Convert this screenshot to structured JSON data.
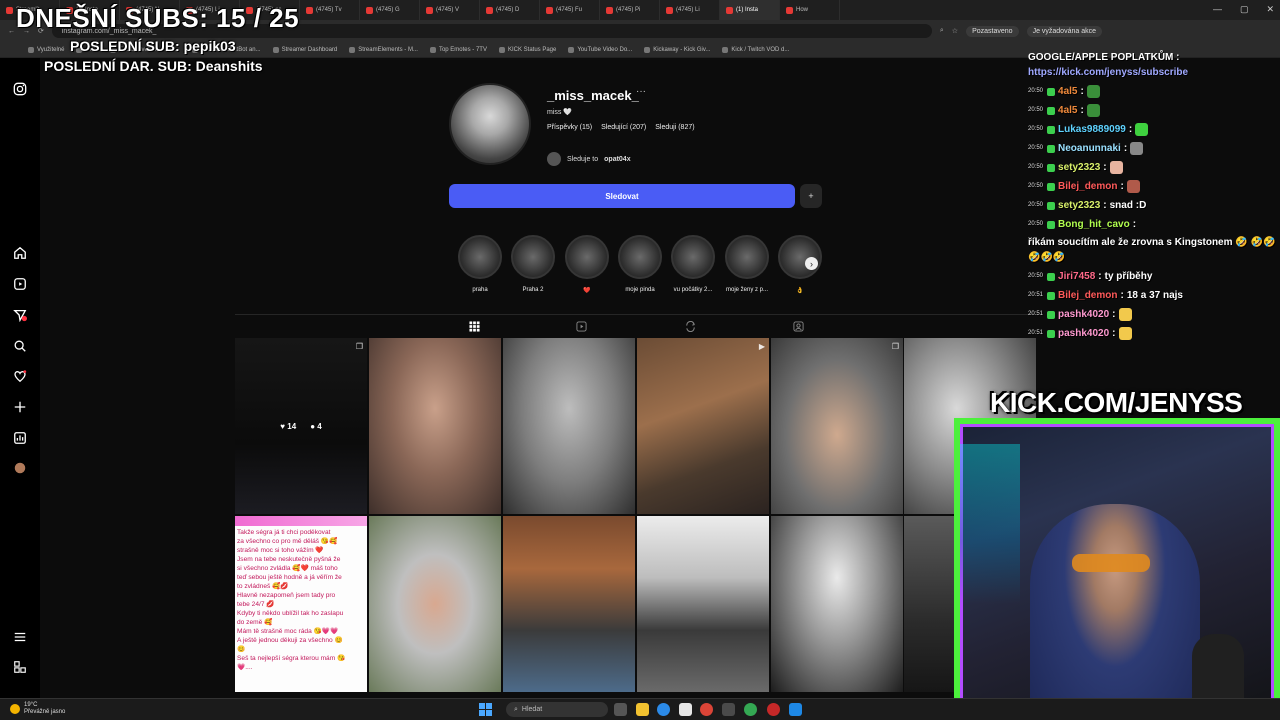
{
  "browser": {
    "tabs": [
      "Streamlit",
      "(4) Insta",
      "(4745) N",
      "(4745) Li",
      "(4745) gc",
      "(4745) Tv",
      "(4745) G",
      "(4745) V",
      "(4745) D",
      "(4745) Fu",
      "(4745) Pi",
      "(4745) Li",
      "(1) Insta",
      "How"
    ],
    "active_tab": 12,
    "url": "instagram.com/_miss_macek_",
    "profile_label": "Pozastaveno",
    "update_label": "Je vyžadována akce",
    "bookmarks": [
      "Využitelné",
      "Chat",
      "File Converter - Free...",
      "The best ChatBot an...",
      "Streamer Dashboard",
      "StreamElements - M...",
      "Top Emotes - 7TV",
      "KICK Status Page",
      "YouTube Video Do...",
      "Kickaway - Kick Giv...",
      "Kick / Twitch VOD d..."
    ]
  },
  "overlay": {
    "subs": "DNEŠNÍ SUBS: 15 / 25",
    "last_sub": "POSLEDNÍ SUB: pepik03",
    "last_dar": "POSLEDNÍ DAR. SUB: Deanshits",
    "kick_url": "KICK.COM/JENYSS"
  },
  "profile": {
    "username": "_miss_macek_",
    "more": "···",
    "bio": "miss 🤍",
    "stats": [
      "Příspěvky (15)",
      "Sledující (207)",
      "Sleduji (827)"
    ],
    "followed_by_prefix": "Sleduje to",
    "followed_by_user": "opat04x",
    "follow_button": "Sledovat",
    "suggest_icon": "+"
  },
  "highlights": [
    {
      "label": "praha"
    },
    {
      "label": "Praha 2"
    },
    {
      "label": "❤️"
    },
    {
      "label": "moje pinda"
    },
    {
      "label": "vu počátky 2..."
    },
    {
      "label": "moje ženy z p..."
    },
    {
      "label": "👌"
    }
  ],
  "post_hover": {
    "likes": "14",
    "comments": "4"
  },
  "note_text": "Takže ségra já ti chci poděkovat\nza všechno co pro mě děláš 😘🥰\nstrašně moc si toho vážím ❤️\nJsem na tebe neskutečně pyšná že\nsi všechno zvládla 🥰❤️ máš toho\nteď sebou ještě hodně a já věřím že\nto zvládneš 🥰💋\nHlavně nezapomeň jsem tady pro\ntebe 24/7 💋\nKdyby ti někdo ublížil tak ho zaslapu\ndo země 🥰\nMám tě strašně moc ráda 😘💗💗\nA ještě jednou děkuji za všechno 😊\n😊\nSeš ta nejlepší ségra kterou mám 😘\n💗....",
  "chat": {
    "header": "GOOGLE/APPLE POPLATKŮM :",
    "link": "https://kick.com/jenyss/subscribe",
    "messages": [
      {
        "time": "20:50",
        "user": "4al5",
        "color": "#f08a3c",
        "text": "",
        "emote": "#3a8f3a"
      },
      {
        "time": "20:50",
        "user": "4al5",
        "color": "#f08a3c",
        "text": "",
        "emote": "#3a8f3a"
      },
      {
        "time": "20:50",
        "user": "Lukas9889099",
        "color": "#5fd3ff",
        "text": "",
        "emote": "#3fd13f"
      },
      {
        "time": "20:50",
        "user": "Neoanunnaki",
        "color": "#9ae0ff",
        "text": "",
        "emote": "#888888"
      },
      {
        "time": "20:50",
        "user": "sety2323",
        "color": "#d9f06a",
        "text": "",
        "emote": "#e8b4a0"
      },
      {
        "time": "20:50",
        "user": "Bilej_demon",
        "color": "#ff5a5a",
        "text": "",
        "emote": "#b05a4a"
      },
      {
        "time": "20:50",
        "user": "sety2323",
        "color": "#d9f06a",
        "text": "snad :D",
        "emote": ""
      },
      {
        "time": "20:50",
        "user": "Bong_hit_cavo",
        "color": "#b2ff4f",
        "text": "říkám soucítím ale že zrovna s Kingstonem 🤣 🤣🤣🤣🤣🤣",
        "emote": ""
      },
      {
        "time": "20:50",
        "user": "Jiri7458",
        "color": "#ff6a8a",
        "text": "ty příběhy",
        "emote": ""
      },
      {
        "time": "20:51",
        "user": "Bilej_demon",
        "color": "#ff5a5a",
        "text": "18 a 37 najs",
        "emote": ""
      },
      {
        "time": "20:51",
        "user": "pashk4020",
        "color": "#ff9ad0",
        "text": "",
        "emote": "#f2c94c"
      },
      {
        "time": "20:51",
        "user": "pashk4020",
        "color": "#ff9ad0",
        "text": "",
        "emote": "#f2c94c"
      }
    ]
  },
  "taskbar": {
    "temp": "19°C",
    "weather": "Převážně jasno",
    "search": "Hledat"
  }
}
